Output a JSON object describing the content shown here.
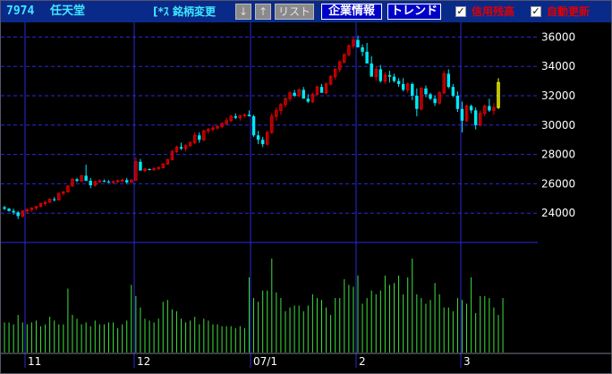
{
  "header": {
    "code": "7974",
    "name": "任天堂",
    "stock_button": "[*ｽ 銘柄変更",
    "down_arrow": "↓",
    "up_arrow": "↑",
    "list_button": "リスト",
    "company_info_button": "企業情報",
    "trend_button": "トレンド",
    "checkbox1": {
      "label": "信用残高",
      "checked": true
    },
    "checkbox2": {
      "label": "自動更新",
      "checked": true
    }
  },
  "colors": {
    "up": "#e00000",
    "down": "#00e8f8",
    "latest": "#ffff00",
    "volume": "#40e040",
    "grid": "#2a2ad8",
    "axis_text": "#ffffff",
    "title_bg": "#0a2a8a"
  },
  "chart_data": [
    {
      "type": "candlestick",
      "y_ticks": [
        24000,
        26000,
        28000,
        30000,
        32000,
        34000,
        36000
      ],
      "ylim": [
        22000,
        37000
      ],
      "x_labels": [
        "11",
        "12",
        "07/1",
        "2",
        "3"
      ],
      "candles": [
        [
          24400,
          24500,
          24200,
          24300
        ],
        [
          24300,
          24350,
          24100,
          24150
        ],
        [
          24150,
          24300,
          23900,
          24050
        ],
        [
          24050,
          24150,
          23600,
          23800
        ],
        [
          23800,
          24200,
          23700,
          24150
        ],
        [
          24150,
          24300,
          24000,
          24250
        ],
        [
          24250,
          24400,
          24100,
          24350
        ],
        [
          24350,
          24500,
          24200,
          24450
        ],
        [
          24450,
          24700,
          24400,
          24650
        ],
        [
          24650,
          24800,
          24500,
          24750
        ],
        [
          24750,
          25000,
          24700,
          24950
        ],
        [
          24950,
          25100,
          24800,
          24900
        ],
        [
          24900,
          25400,
          24850,
          25350
        ],
        [
          25350,
          25500,
          25200,
          25450
        ],
        [
          25450,
          25900,
          25400,
          25850
        ],
        [
          25850,
          26400,
          25800,
          26300
        ],
        [
          26300,
          26400,
          26100,
          26200
        ],
        [
          26200,
          26600,
          26100,
          26550
        ],
        [
          26550,
          27300,
          26500,
          26200
        ],
        [
          26200,
          26400,
          25700,
          25900
        ],
        [
          25900,
          26200,
          25800,
          26150
        ],
        [
          26150,
          26300,
          26050,
          26200
        ],
        [
          26200,
          26300,
          26100,
          26150
        ],
        [
          26150,
          26250,
          26050,
          26100
        ],
        [
          26100,
          26200,
          26000,
          26150
        ],
        [
          26150,
          26300,
          26050,
          26200
        ],
        [
          26200,
          26350,
          26100,
          26250
        ],
        [
          26250,
          26400,
          26000,
          26100
        ],
        [
          26100,
          26300,
          26050,
          26250
        ],
        [
          26250,
          27800,
          26200,
          27500
        ],
        [
          27500,
          27700,
          27000,
          26900
        ],
        [
          26900,
          27100,
          26800,
          27000
        ],
        [
          27000,
          27050,
          26900,
          26950
        ],
        [
          26950,
          27100,
          26900,
          27050
        ],
        [
          27050,
          27200,
          26950,
          27100
        ],
        [
          27100,
          27400,
          27050,
          27350
        ],
        [
          27350,
          27700,
          27300,
          27650
        ],
        [
          27650,
          28300,
          27600,
          28200
        ],
        [
          28200,
          28600,
          28100,
          28500
        ],
        [
          28500,
          28800,
          28300,
          28400
        ],
        [
          28400,
          28700,
          28200,
          28600
        ],
        [
          28600,
          28900,
          28500,
          28800
        ],
        [
          28800,
          29500,
          28700,
          29300
        ],
        [
          29300,
          29500,
          28800,
          29000
        ],
        [
          29000,
          29700,
          28900,
          29600
        ],
        [
          29600,
          29800,
          29400,
          29700
        ],
        [
          29700,
          30000,
          29600,
          29800
        ],
        [
          29800,
          30000,
          29700,
          29900
        ],
        [
          29900,
          30200,
          29800,
          30100
        ],
        [
          30100,
          30500,
          30000,
          30300
        ],
        [
          30300,
          30700,
          30200,
          30600
        ],
        [
          30600,
          30800,
          30400,
          30500
        ],
        [
          30500,
          30700,
          30300,
          30650
        ],
        [
          30650,
          30800,
          30500,
          30700
        ],
        [
          30700,
          31000,
          30600,
          30600
        ],
        [
          30600,
          30700,
          29200,
          29300
        ],
        [
          29300,
          29600,
          28700,
          29000
        ],
        [
          29000,
          29200,
          28500,
          28700
        ],
        [
          28700,
          29600,
          28600,
          29500
        ],
        [
          29500,
          30800,
          29400,
          30600
        ],
        [
          30600,
          31200,
          30300,
          31000
        ],
        [
          31000,
          31500,
          30700,
          31400
        ],
        [
          31400,
          31900,
          31200,
          31800
        ],
        [
          31800,
          32300,
          31600,
          32200
        ],
        [
          32200,
          32400,
          31900,
          32000
        ],
        [
          32000,
          32500,
          31900,
          32400
        ],
        [
          32400,
          32600,
          31900,
          31800
        ],
        [
          31800,
          32100,
          31500,
          31600
        ],
        [
          31600,
          32200,
          31500,
          32100
        ],
        [
          32100,
          32700,
          32000,
          32600
        ],
        [
          32600,
          32800,
          32300,
          32200
        ],
        [
          32200,
          32900,
          32100,
          32800
        ],
        [
          32800,
          33400,
          32700,
          33300
        ],
        [
          33300,
          33900,
          33100,
          33800
        ],
        [
          33800,
          34400,
          33600,
          34300
        ],
        [
          34300,
          34900,
          34200,
          34800
        ],
        [
          34800,
          35500,
          34700,
          35400
        ],
        [
          35400,
          36000,
          35200,
          35800
        ],
        [
          35800,
          36100,
          35300,
          35300
        ],
        [
          35300,
          35500,
          34700,
          35000
        ],
        [
          35000,
          35600,
          34500,
          34200
        ],
        [
          34200,
          34700,
          33400,
          33300
        ],
        [
          33300,
          34000,
          33000,
          33800
        ],
        [
          33800,
          34100,
          32900,
          33000
        ],
        [
          33000,
          33600,
          32800,
          33400
        ],
        [
          33400,
          33700,
          32900,
          33300
        ],
        [
          33300,
          33500,
          32900,
          33000
        ],
        [
          33000,
          33200,
          32600,
          32800
        ],
        [
          32800,
          33200,
          32300,
          32400
        ],
        [
          32400,
          32900,
          32200,
          32800
        ],
        [
          32800,
          32900,
          31700,
          32000
        ],
        [
          32000,
          32500,
          30600,
          31100
        ],
        [
          31100,
          32600,
          31000,
          32500
        ],
        [
          32500,
          32700,
          31900,
          32100
        ],
        [
          32100,
          32200,
          31700,
          31800
        ],
        [
          31800,
          32000,
          31300,
          31500
        ],
        [
          31500,
          32300,
          31400,
          32200
        ],
        [
          32200,
          33700,
          32100,
          33500
        ],
        [
          33500,
          33800,
          32500,
          32600
        ],
        [
          32600,
          32800,
          31900,
          32000
        ],
        [
          32000,
          32300,
          30900,
          31100
        ],
        [
          31100,
          31600,
          29500,
          30300
        ],
        [
          30300,
          31400,
          30200,
          31300
        ],
        [
          31300,
          31400,
          30800,
          31000
        ],
        [
          31000,
          31200,
          29700,
          30000
        ],
        [
          30000,
          31000,
          29900,
          30800
        ],
        [
          30800,
          31400,
          30600,
          31300
        ],
        [
          31300,
          31800,
          30900,
          31000
        ],
        [
          31000,
          31500,
          30700,
          31200
        ],
        [
          31200,
          33200,
          31100,
          32900
        ]
      ],
      "volume": [
        0.32,
        0.32,
        0.3,
        0.4,
        0.32,
        0.3,
        0.32,
        0.34,
        0.28,
        0.3,
        0.38,
        0.34,
        0.3,
        0.3,
        0.68,
        0.4,
        0.36,
        0.3,
        0.32,
        0.28,
        0.34,
        0.3,
        0.3,
        0.32,
        0.32,
        0.26,
        0.3,
        0.34,
        0.72,
        0.6,
        0.48,
        0.36,
        0.34,
        0.32,
        0.36,
        0.54,
        0.56,
        0.46,
        0.44,
        0.36,
        0.32,
        0.34,
        0.38,
        0.3,
        0.36,
        0.34,
        0.3,
        0.3,
        0.28,
        0.28,
        0.28,
        0.26,
        0.28,
        0.26,
        0.8,
        0.58,
        0.54,
        0.66,
        0.66,
        1.0,
        0.64,
        0.58,
        0.44,
        0.48,
        0.5,
        0.5,
        0.44,
        0.5,
        0.62,
        0.58,
        0.56,
        0.48,
        0.4,
        0.58,
        0.58,
        0.78,
        0.72,
        0.7,
        0.82,
        0.52,
        0.58,
        0.66,
        0.62,
        0.66,
        0.82,
        0.72,
        0.74,
        0.82,
        0.62,
        0.8,
        1.0,
        0.62,
        0.58,
        0.52,
        0.56,
        0.74,
        0.62,
        0.48,
        0.48,
        0.44,
        0.58,
        0.56,
        0.52,
        0.8,
        0.42,
        0.6,
        0.6,
        0.58,
        0.48,
        0.4,
        0.58
      ]
    }
  ]
}
